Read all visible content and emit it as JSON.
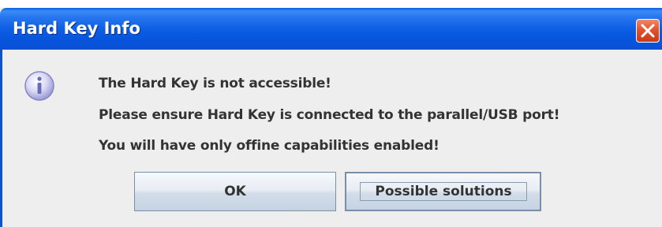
{
  "window": {
    "title": "Hard Key Info",
    "close_icon": "close-icon"
  },
  "dialog": {
    "icon": "info-icon",
    "messages": [
      "The Hard Key is not accessible!",
      "Please ensure Hard Key is connected to the parallel/USB port!",
      "You will have only offine capabilities enabled!"
    ]
  },
  "buttons": {
    "ok_label": "OK",
    "solutions_label": "Possible solutions"
  },
  "colors": {
    "titlebar": "#0a52d2",
    "close": "#e0542e",
    "body": "#eeeeee"
  }
}
